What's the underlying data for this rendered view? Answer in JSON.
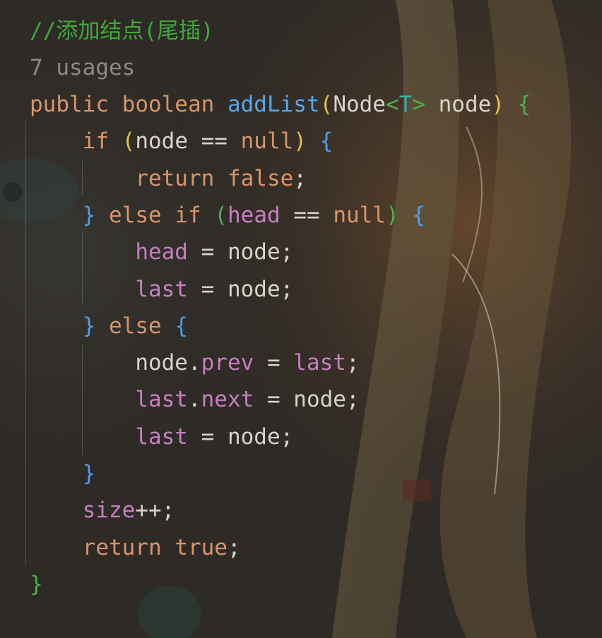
{
  "theme": {
    "comment": "#3fa83c",
    "hint": "#8a8a86",
    "keyword": "#d8946a",
    "function": "#57a7ec",
    "plain": "#d8d4cc",
    "field": "#c57fbf",
    "type_param": "#2fb5a6",
    "bracket_yellow": "#e2c04a",
    "bracket_green": "#4caf50",
    "bracket_blue": "#4a9ef0"
  },
  "code": {
    "comment": "//添加结点(尾插)",
    "usages": "7 usages",
    "lines": [
      [
        {
          "t": "public",
          "c": "kw"
        },
        {
          "t": " ",
          "c": "plain"
        },
        {
          "t": "boolean",
          "c": "kw"
        },
        {
          "t": " ",
          "c": "plain"
        },
        {
          "t": "addList",
          "c": "fn"
        },
        {
          "t": "(",
          "c": "p1"
        },
        {
          "t": "Node",
          "c": "plain"
        },
        {
          "t": "<",
          "c": "p2"
        },
        {
          "t": "T",
          "c": "type"
        },
        {
          "t": ">",
          "c": "p2"
        },
        {
          "t": " node",
          "c": "plain"
        },
        {
          "t": ")",
          "c": "p1"
        },
        {
          "t": " ",
          "c": "plain"
        },
        {
          "t": "{",
          "c": "p2"
        }
      ],
      [
        {
          "t": "    ",
          "c": "plain"
        },
        {
          "t": "if",
          "c": "kw"
        },
        {
          "t": " ",
          "c": "plain"
        },
        {
          "t": "(",
          "c": "p1"
        },
        {
          "t": "node == ",
          "c": "plain"
        },
        {
          "t": "null",
          "c": "kw"
        },
        {
          "t": ")",
          "c": "p1"
        },
        {
          "t": " ",
          "c": "plain"
        },
        {
          "t": "{",
          "c": "p3"
        }
      ],
      [
        {
          "t": "        ",
          "c": "plain"
        },
        {
          "t": "return",
          "c": "kw"
        },
        {
          "t": " ",
          "c": "plain"
        },
        {
          "t": "false",
          "c": "kw"
        },
        {
          "t": ";",
          "c": "plain"
        }
      ],
      [
        {
          "t": "    ",
          "c": "plain"
        },
        {
          "t": "}",
          "c": "p3"
        },
        {
          "t": " ",
          "c": "plain"
        },
        {
          "t": "else",
          "c": "kw"
        },
        {
          "t": " ",
          "c": "plain"
        },
        {
          "t": "if",
          "c": "kw"
        },
        {
          "t": " ",
          "c": "plain"
        },
        {
          "t": "(",
          "c": "p2"
        },
        {
          "t": "head",
          "c": "field"
        },
        {
          "t": " == ",
          "c": "plain"
        },
        {
          "t": "null",
          "c": "kw"
        },
        {
          "t": ")",
          "c": "p2"
        },
        {
          "t": " ",
          "c": "plain"
        },
        {
          "t": "{",
          "c": "p3"
        }
      ],
      [
        {
          "t": "        ",
          "c": "plain"
        },
        {
          "t": "head",
          "c": "field"
        },
        {
          "t": " = node;",
          "c": "plain"
        }
      ],
      [
        {
          "t": "        ",
          "c": "plain"
        },
        {
          "t": "last",
          "c": "field"
        },
        {
          "t": " = node;",
          "c": "plain"
        }
      ],
      [
        {
          "t": "    ",
          "c": "plain"
        },
        {
          "t": "}",
          "c": "p3"
        },
        {
          "t": " ",
          "c": "plain"
        },
        {
          "t": "else",
          "c": "kw"
        },
        {
          "t": " ",
          "c": "plain"
        },
        {
          "t": "{",
          "c": "p3"
        }
      ],
      [
        {
          "t": "        ",
          "c": "plain"
        },
        {
          "t": "node.",
          "c": "plain"
        },
        {
          "t": "prev",
          "c": "field"
        },
        {
          "t": " = ",
          "c": "plain"
        },
        {
          "t": "last",
          "c": "field"
        },
        {
          "t": ";",
          "c": "plain"
        }
      ],
      [
        {
          "t": "        ",
          "c": "plain"
        },
        {
          "t": "last",
          "c": "field"
        },
        {
          "t": ".",
          "c": "plain"
        },
        {
          "t": "next",
          "c": "field"
        },
        {
          "t": " = node;",
          "c": "plain"
        }
      ],
      [
        {
          "t": "        ",
          "c": "plain"
        },
        {
          "t": "last",
          "c": "field"
        },
        {
          "t": " = node;",
          "c": "plain"
        }
      ],
      [
        {
          "t": "    ",
          "c": "plain"
        },
        {
          "t": "}",
          "c": "p3"
        }
      ],
      [
        {
          "t": "    ",
          "c": "plain"
        },
        {
          "t": "size",
          "c": "field"
        },
        {
          "t": "++;",
          "c": "plain"
        }
      ],
      [
        {
          "t": "    ",
          "c": "plain"
        },
        {
          "t": "return",
          "c": "kw"
        },
        {
          "t": " ",
          "c": "plain"
        },
        {
          "t": "true",
          "c": "kw"
        },
        {
          "t": ";",
          "c": "plain"
        }
      ],
      [
        {
          "t": "}",
          "c": "p2"
        }
      ]
    ]
  }
}
